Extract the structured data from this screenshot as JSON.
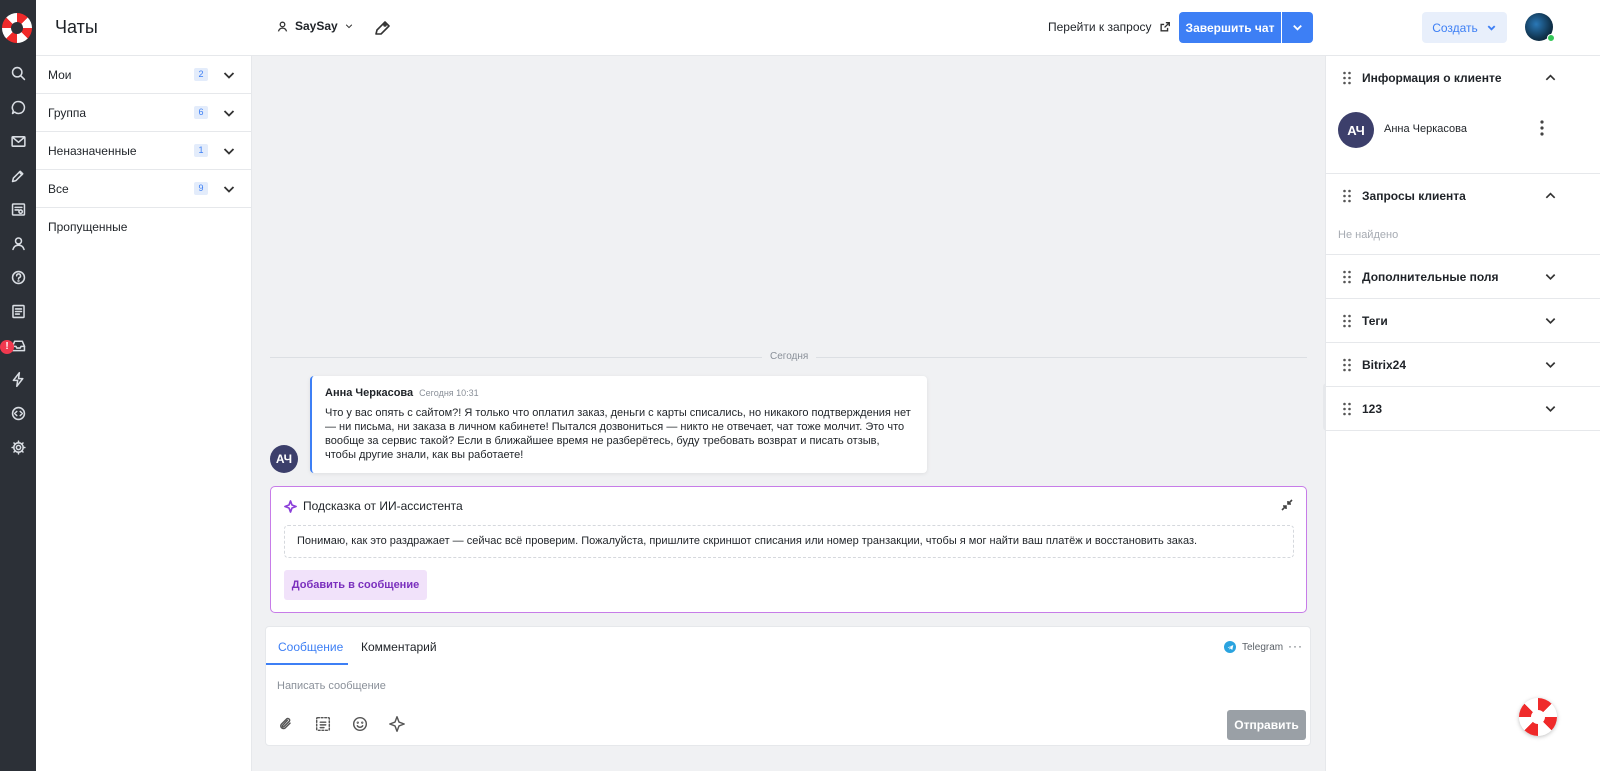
{
  "header": {
    "title": "Чаты",
    "agent_name": "SaySay",
    "goto_request_label": "Перейти к запросу",
    "finish_chat_label": "Завершить чат",
    "create_label": "Создать"
  },
  "rail": {
    "badge": "!",
    "icons": [
      "search-icon",
      "chat-bubble-icon",
      "mail-icon",
      "edit-tag-icon",
      "knowledge-base-icon",
      "user-icon",
      "help-icon",
      "document-icon",
      "inbox-icon",
      "lightning-icon",
      "code-icon",
      "settings-icon"
    ]
  },
  "chat_groups": [
    {
      "label": "Мои",
      "count": "2"
    },
    {
      "label": "Группа",
      "count": "6"
    },
    {
      "label": "Неназначенные",
      "count": "1"
    },
    {
      "label": "Все",
      "count": "9"
    },
    {
      "label": "Пропущенные",
      "count": ""
    }
  ],
  "conversation": {
    "date_divider": "Сегодня",
    "message": {
      "avatar_initials": "АЧ",
      "author": "Анна Черкасова",
      "time": "Сегодня 10:31",
      "text": "Что у вас опять с сайтом?! Я только что оплатил заказ, деньги с карты списались, но никакого подтверждения нет — ни письма, ни заказа в личном кабинете! Пытался дозвониться — никто не отвечает, чат тоже молчит. Это что вообще за сервис такой? Если в ближайшее время не разберётесь, буду требовать возврат и писать отзыв, чтобы другие знали, как вы работаете!"
    },
    "ai_hint": {
      "title": "Подсказка от ИИ-ассистента",
      "suggestion": "Понимаю, как это раздражает — сейчас всё проверим. Пожалуйста, пришлите скриншот списания или номер транзакции, чтобы я мог найти ваш платёж и восстановить заказ.",
      "add_button": "Добавить в сообщение"
    }
  },
  "composer": {
    "tabs": [
      "Сообщение",
      "Комментарий"
    ],
    "active_tab": "Сообщение",
    "channel": "Telegram",
    "more": "···",
    "placeholder": "Написать сообщение",
    "value": "",
    "send_label": "Отправить"
  },
  "client_panel": {
    "sections": [
      {
        "title": "Информация о клиенте",
        "expanded": true
      },
      {
        "title": "Запросы клиента",
        "expanded": true
      },
      {
        "title": "Дополнительные поля",
        "expanded": false
      },
      {
        "title": "Теги",
        "expanded": false
      },
      {
        "title": "Bitrix24",
        "expanded": false
      },
      {
        "title": "123",
        "expanded": false
      }
    ],
    "client_initials": "АЧ",
    "client_name": "Анна Черкасова",
    "requests_empty": "Не найдено"
  },
  "colors": {
    "accent": "#3d7ff5",
    "ai_border": "#c77ce8",
    "ai_button_bg": "#f1e2fa",
    "rail_bg": "#2c3037",
    "avatar_bg": "#3c3f6b",
    "online": "#35c759"
  }
}
